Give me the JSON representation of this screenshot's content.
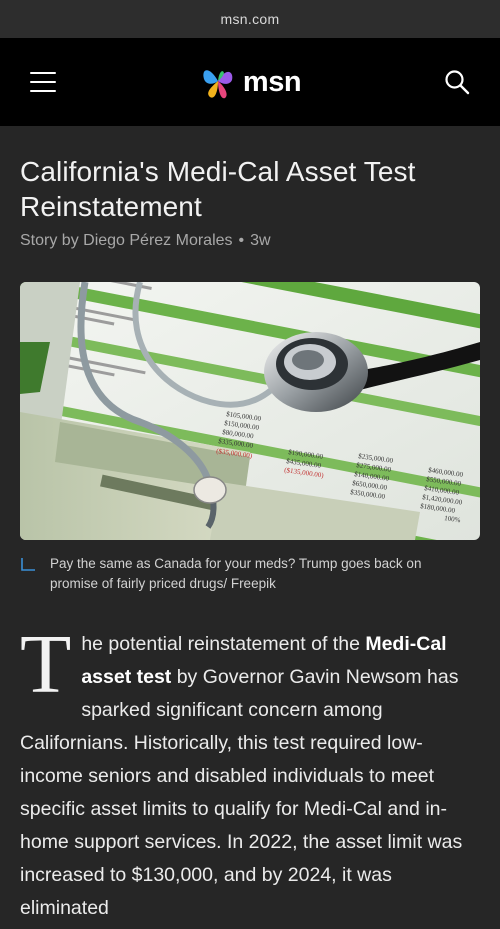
{
  "browser": {
    "url": "msn.com"
  },
  "nav": {
    "brand": "msn"
  },
  "article": {
    "title": "California's Medi-Cal Asset Test Reinstatement",
    "byline": {
      "prefix": "Story by Diego Pérez Morales",
      "separator": "•",
      "age": "3w"
    },
    "caption": "Pay the same as Canada for your meds? Trump goes back on promise of fairly priced drugs/ Freepik",
    "body": {
      "dropcap": "T",
      "part1": "he potential reinstatement of the ",
      "bold": "Medi-Cal asset test",
      "part2": " by Governor Gavin Newsom has sparked significant concern among Californians. Historically, this test required low-income seniors and disabled individuals to meet specific asset limits to qualify for Medi-Cal and in-home support services. In 2022, the asset limit was increased to $130,000, and by 2024, it was eliminated"
    }
  },
  "hero_image": {
    "sheet_values": [
      "$105,000.00",
      "$150,000.00",
      "$80,000.00",
      "$335,000.00",
      "($35,000.00)",
      "$190,000.00",
      "$435,000.00",
      "($135,000.00)",
      "$235,000.00",
      "$275,000.00",
      "$140,000.00",
      "$650,000.00",
      "$350,000.00",
      "$460,000.00",
      "$550,000.00",
      "$410,000.00",
      "$1,420,000.00",
      "$180,000.00",
      "100%"
    ]
  },
  "colors": {
    "nav_bg": "#000000",
    "page_bg": "#262626",
    "accent_caption": "#3a8fd6"
  }
}
